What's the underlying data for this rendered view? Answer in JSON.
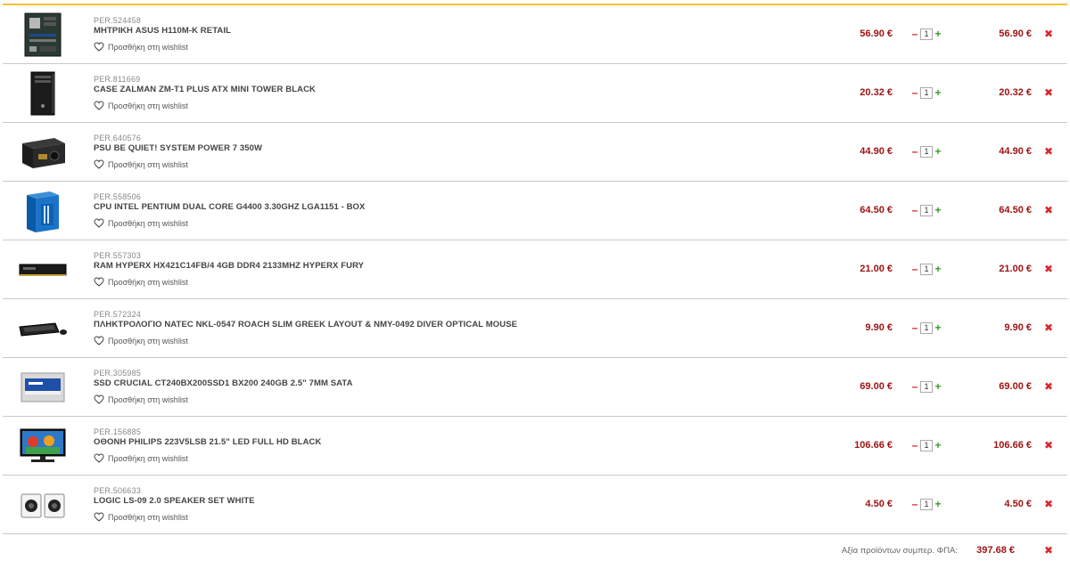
{
  "cart": {
    "wishlist_label": "Προσθήκη στη wishlist",
    "items": [
      {
        "code": "PER.524458",
        "title": "ΜΗΤΡΙΚΗ ASUS H110M-K RETAIL",
        "price": "56.90 €",
        "qty": "1",
        "total": "56.90 €"
      },
      {
        "code": "PER.811669",
        "title": "CASE ZALMAN ZM-T1 PLUS ATX MINI TOWER BLACK",
        "price": "20.32 €",
        "qty": "1",
        "total": "20.32 €"
      },
      {
        "code": "PER.640576",
        "title": "PSU BE QUIET! SYSTEM POWER 7 350W",
        "price": "44.90 €",
        "qty": "1",
        "total": "44.90 €"
      },
      {
        "code": "PER.558506",
        "title": "CPU INTEL PENTIUM DUAL CORE G4400 3.30GHZ LGA1151 - BOX",
        "price": "64.50 €",
        "qty": "1",
        "total": "64.50 €"
      },
      {
        "code": "PER.557303",
        "title": "RAM HYPERX HX421C14FB/4 4GB DDR4 2133MHZ HYPERX FURY",
        "price": "21.00 €",
        "qty": "1",
        "total": "21.00 €"
      },
      {
        "code": "PER.572324",
        "title": "ΠΛΗΚΤΡΟΛΟΓΙΟ NATEC NKL-0547 ROACH SLIM GREEK LAYOUT & NMY-0492 DIVER OPTICAL MOUSE",
        "price": "9.90 €",
        "qty": "1",
        "total": "9.90 €"
      },
      {
        "code": "PER.305985",
        "title": "SSD CRUCIAL CT240BX200SSD1 BX200 240GB 2.5\" 7MM SATA",
        "price": "69.00 €",
        "qty": "1",
        "total": "69.00 €"
      },
      {
        "code": "PER.156885",
        "title": "ΟΘΟΝΗ PHILIPS 223V5LSB 21.5\" LED FULL HD BLACK",
        "price": "106.66 €",
        "qty": "1",
        "total": "106.66 €"
      },
      {
        "code": "PER.506633",
        "title": "LOGIC LS-09 2.0 SPEAKER SET WHITE",
        "price": "4.50 €",
        "qty": "1",
        "total": "4.50 €"
      }
    ],
    "icons": {
      "remove": "close-icon",
      "wishlist": "heart-icon",
      "minus": "minus-icon",
      "plus": "plus-icon"
    },
    "summary": {
      "label": "Αξία προϊόντων συμπερ. ΦΠΑ:",
      "value": "397.68 €"
    },
    "colors": {
      "accent": "#f6c12e",
      "price": "#a01313",
      "remove": "#d9262b",
      "plus": "#3a9a2a"
    },
    "remove_glyph": "✖",
    "minus_glyph": "–",
    "plus_glyph": "+"
  }
}
